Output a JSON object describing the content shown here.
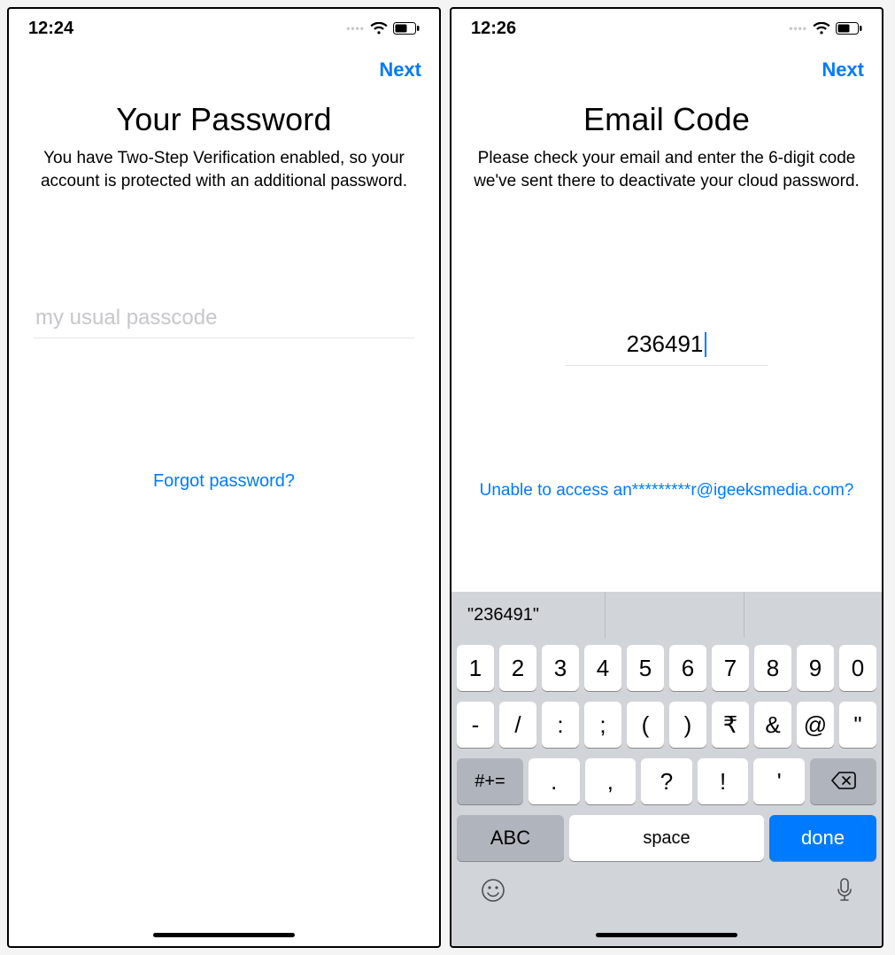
{
  "left": {
    "status": {
      "time": "12:24"
    },
    "nav": {
      "next": "Next"
    },
    "title": "Your Password",
    "desc": "You have Two-Step Verification enabled, so your account is protected with an additional password.",
    "input": {
      "placeholder": "my usual passcode",
      "value": ""
    },
    "forgot": "Forgot password?"
  },
  "right": {
    "status": {
      "time": "12:26"
    },
    "nav": {
      "next": "Next"
    },
    "title": "Email Code",
    "desc": "Please check your email and enter the 6-digit code we've sent there to deactivate your cloud password.",
    "code": "236491",
    "unable": "Unable to access an*********r@igeeksmedia.com?",
    "keyboard": {
      "suggestion": "\"236491\"",
      "row1": [
        "1",
        "2",
        "3",
        "4",
        "5",
        "6",
        "7",
        "8",
        "9",
        "0"
      ],
      "row2": [
        "-",
        "/",
        ":",
        ";",
        "(",
        ")",
        "₹",
        "&",
        "@",
        "\""
      ],
      "row3_alt": "#+=",
      "row3": [
        ".",
        ",",
        "?",
        "!",
        "'"
      ],
      "abc": "ABC",
      "space": "space",
      "done": "done"
    }
  }
}
